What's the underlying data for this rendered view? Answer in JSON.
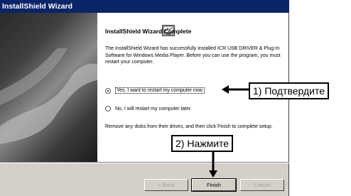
{
  "window": {
    "title": "InstallShield Wizard"
  },
  "dialog": {
    "heading": "InstallShield Wizard Complete",
    "body_text": "The InstallShield Wizard has successfully installed ICR USB DRIVER & Plug-In Software for Windows Media Player.  Before you can use the program, you must restart your computer.",
    "options": [
      {
        "label": "Yes, I want to restart my computer now.",
        "selected": true
      },
      {
        "label": "No, I will restart my computer later.",
        "selected": false
      }
    ],
    "footer_text": "Remove any disks from their drives, and then click Finish to complete setup.",
    "buttons": {
      "back": "< Back",
      "finish": "Finish",
      "cancel": "Cancel"
    }
  },
  "annotations": {
    "step1": "1) Подтвердите",
    "step2": "2) Нажмите"
  }
}
